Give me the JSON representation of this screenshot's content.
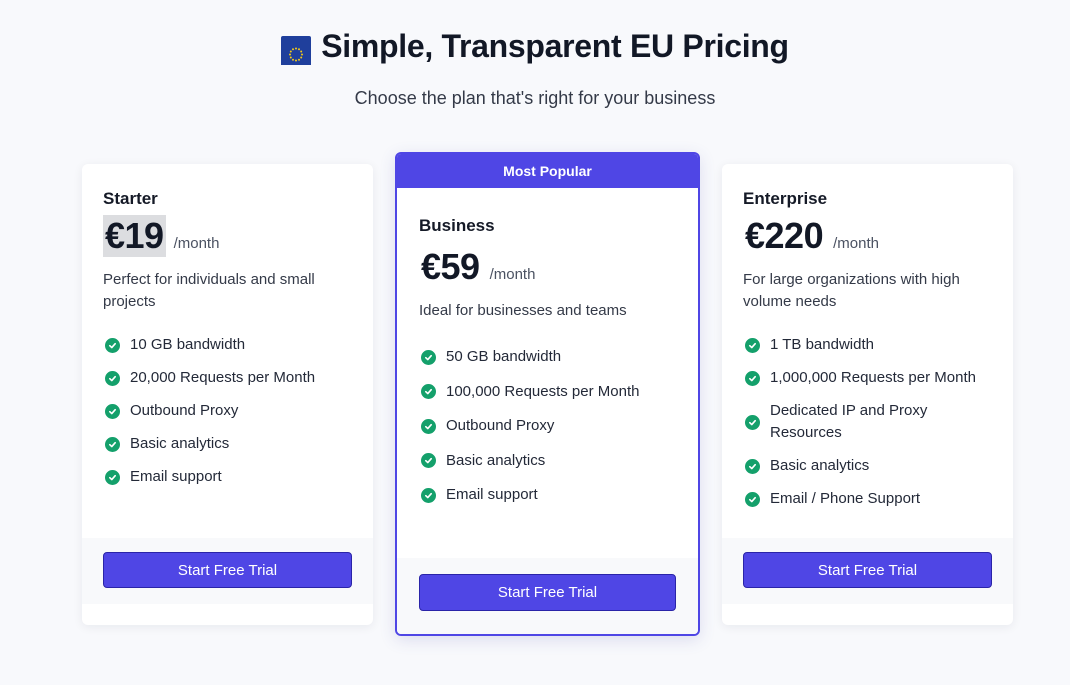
{
  "header": {
    "flag_icon": "eu-flag-icon",
    "title": "Simple, Transparent EU Pricing",
    "subtitle": "Choose the plan that's right for your business"
  },
  "colors": {
    "accent": "#4f46e5",
    "check": "#14a06b",
    "page_background": "#f8f9fc"
  },
  "plans": [
    {
      "name": "Starter",
      "price": "€19",
      "period": "/month",
      "description": "Perfect for individuals and small projects",
      "features": [
        "10 GB bandwidth",
        "20,000 Requests per Month",
        "Outbound Proxy",
        "Basic analytics",
        "Email support"
      ],
      "cta": "Start Free Trial"
    },
    {
      "badge": "Most Popular",
      "name": "Business",
      "price": "€59",
      "period": "/month",
      "description": "Ideal for businesses and teams",
      "features": [
        "50 GB bandwidth",
        "100,000 Requests per Month",
        "Outbound Proxy",
        "Basic analytics",
        "Email support"
      ],
      "cta": "Start Free Trial"
    },
    {
      "name": "Enterprise",
      "price": "€220",
      "period": "/month",
      "description": "For large organizations with high volume needs",
      "features": [
        "1 TB bandwidth",
        "1,000,000 Requests per Month",
        "Dedicated IP and Proxy Resources",
        "Basic analytics",
        "Email / Phone Support"
      ],
      "cta": "Start Free Trial"
    }
  ]
}
